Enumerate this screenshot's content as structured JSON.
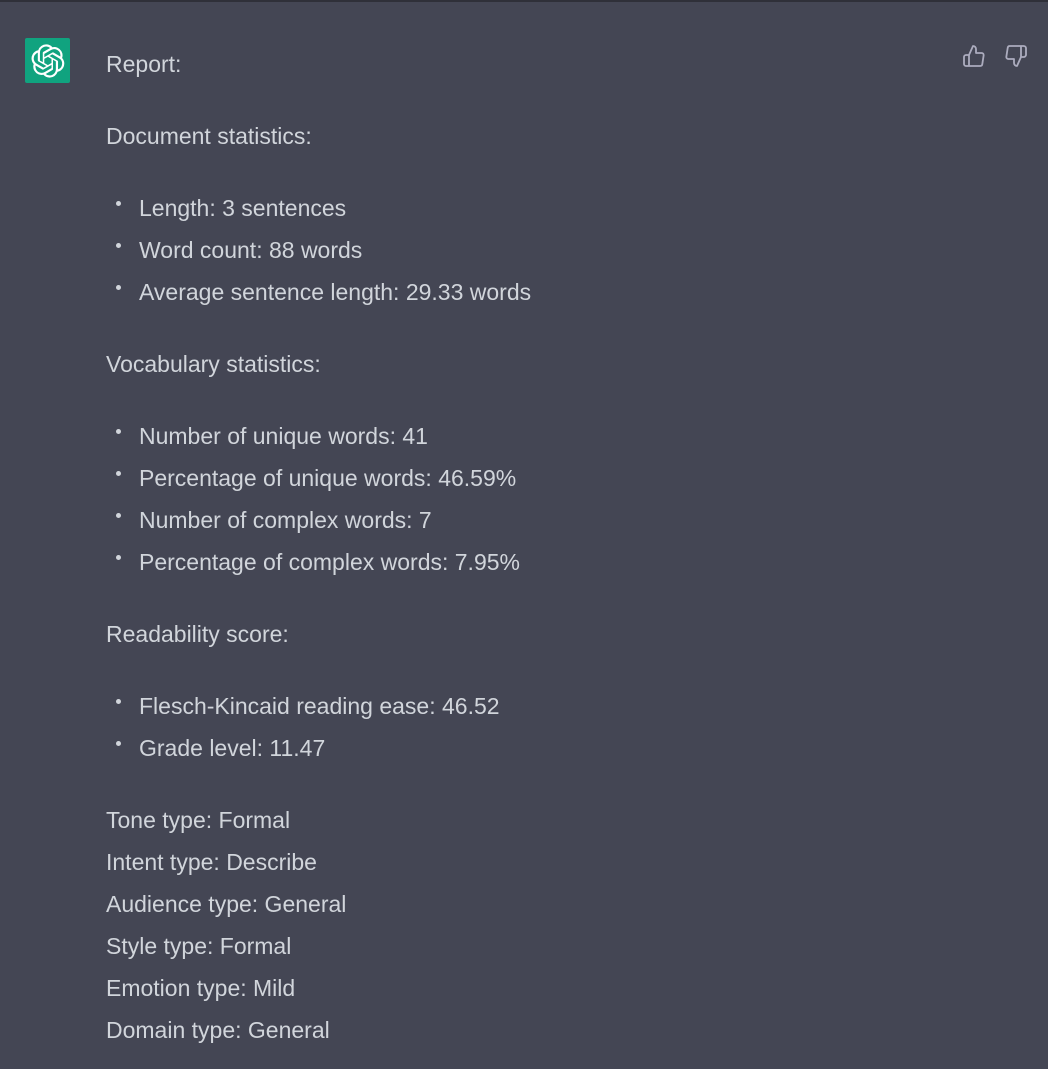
{
  "message": {
    "avatar_icon": "openai-logo-icon",
    "feedback": {
      "like_icon": "thumbs-up-icon",
      "dislike_icon": "thumbs-down-icon"
    },
    "intro": "Report:",
    "sections": [
      {
        "heading": "Document statistics:",
        "items": [
          "Length: 3 sentences",
          "Word count: 88 words",
          "Average sentence length: 29.33 words"
        ]
      },
      {
        "heading": "Vocabulary statistics:",
        "items": [
          "Number of unique words: 41",
          "Percentage of unique words: 46.59%",
          "Number of complex words: 7",
          "Percentage of complex words: 7.95%"
        ]
      },
      {
        "heading": "Readability score:",
        "items": [
          "Flesch-Kincaid reading ease: 46.52",
          "Grade level: 11.47"
        ]
      }
    ],
    "types": [
      "Tone type: Formal",
      "Intent type: Describe",
      "Audience type: General",
      "Style type: Formal",
      "Emotion type: Mild",
      "Domain type: General"
    ]
  },
  "colors": {
    "background": "#444654",
    "text": "#d1d5db",
    "avatar_bg": "#10a37f"
  }
}
